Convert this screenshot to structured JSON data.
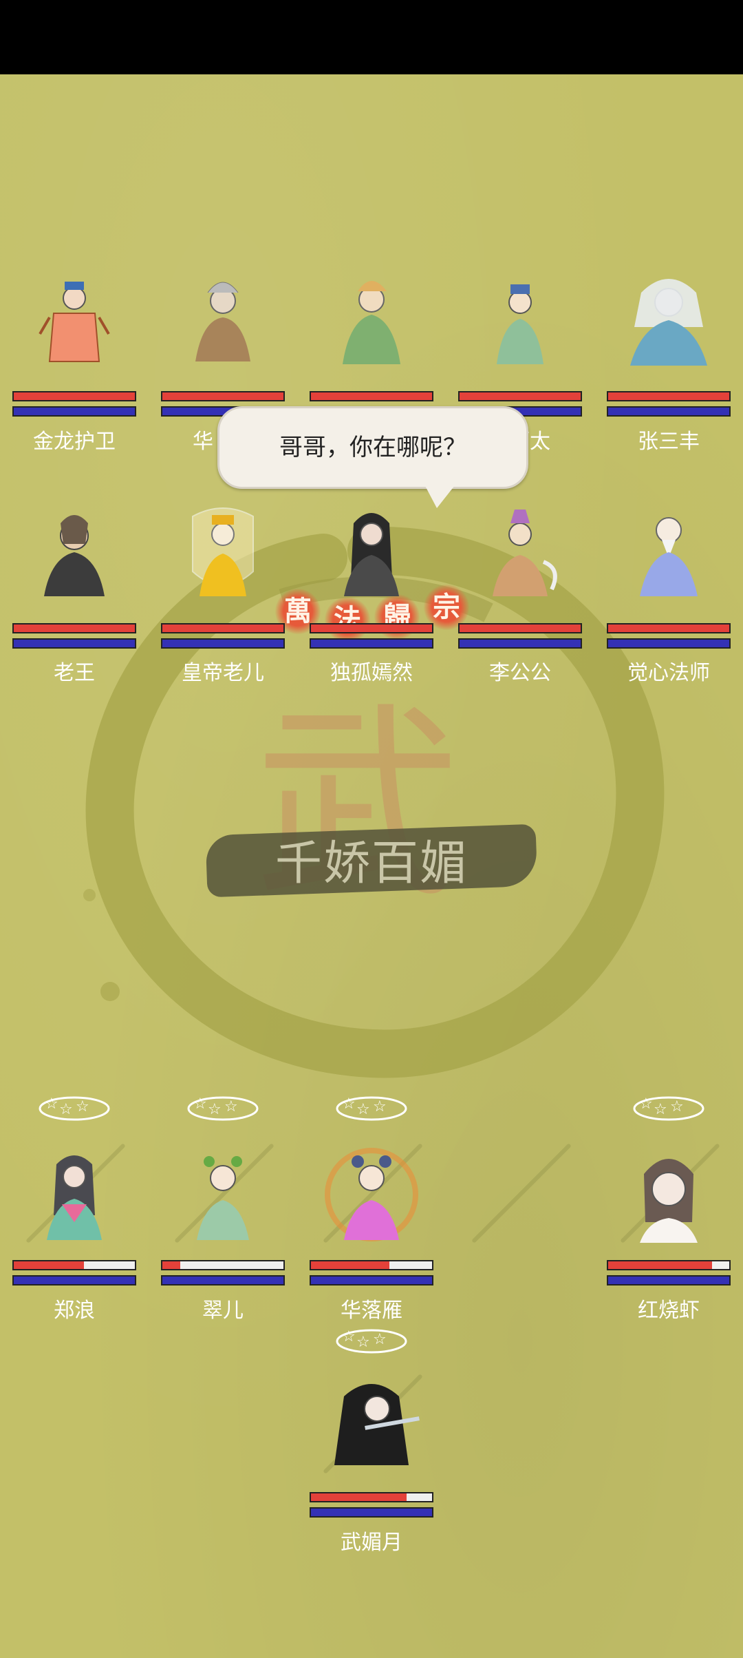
{
  "emblem": {
    "title": "千娇百媚",
    "seal_chars": [
      "萬",
      "法",
      "歸",
      "宗"
    ]
  },
  "dialog": {
    "text": "哥哥，你在哪呢？"
  },
  "row1": [
    {
      "name": "金龙护卫",
      "hp": 1.0,
      "mp": 1.0
    },
    {
      "name": "华",
      "hp": 1.0,
      "mp": 1.0
    },
    {
      "name": "",
      "hp": 1.0,
      "mp": 1.0
    },
    {
      "name": "师太",
      "hp": 1.0,
      "mp": 1.0
    },
    {
      "name": "张三丰",
      "hp": 1.0,
      "mp": 1.0
    }
  ],
  "row2": [
    {
      "name": "老王",
      "hp": 1.0,
      "mp": 1.0
    },
    {
      "name": "皇帝老儿",
      "hp": 1.0,
      "mp": 1.0
    },
    {
      "name": "独孤嫣然",
      "hp": 1.0,
      "mp": 1.0
    },
    {
      "name": "李公公",
      "hp": 1.0,
      "mp": 1.0
    },
    {
      "name": "觉心法师",
      "hp": 1.0,
      "mp": 1.0
    }
  ],
  "row3": [
    {
      "name": "郑浪",
      "hp": 0.58,
      "mp": 1.0
    },
    {
      "name": "翠儿",
      "hp": 0.15,
      "mp": 1.0
    },
    {
      "name": "华落雁",
      "hp": 0.65,
      "mp": 1.0
    },
    {
      "name": "红烧虾",
      "hp": 0.86,
      "mp": 1.0
    }
  ],
  "row4": [
    {
      "name": "武媚月",
      "hp": 0.79,
      "mp": 1.0
    }
  ],
  "colors": {
    "hp": "#e3413a",
    "mp": "#3431b5",
    "background": "#c3c068"
  }
}
